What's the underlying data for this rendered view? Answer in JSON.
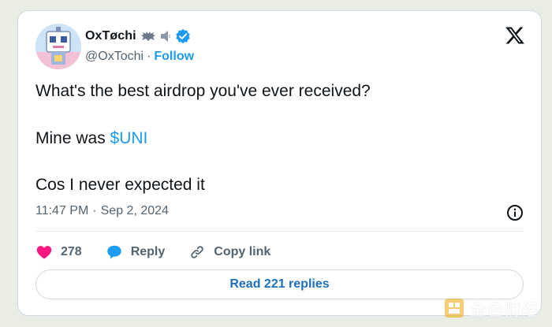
{
  "tweet": {
    "display_name": "OxTøchi",
    "handle": "@OxTochi",
    "separator": "·",
    "follow_label": "Follow",
    "lines": [
      "What's the best airdrop you've ever received?",
      "Mine was ",
      "Cos I never expected it"
    ],
    "cashtag": "$UNI",
    "time": "11:47 PM",
    "date": "Sep 2, 2024",
    "likes": "278",
    "reply_label": "Reply",
    "copy_link_label": "Copy link",
    "read_replies_label": "Read 221 replies"
  },
  "watermark": {
    "text": "金色财经"
  },
  "icons": {
    "avatar": "robot-avatar",
    "verified": "verified-badge-icon",
    "close": "x-logo-icon",
    "info": "info-icon",
    "like": "heart-icon",
    "reply": "reply-bubble-icon",
    "copy": "link-icon"
  },
  "colors": {
    "accent": "#1d9bf0",
    "like": "#f91880",
    "reply": "#1d9bf0",
    "text": "#0f1419",
    "muted": "#536471",
    "border": "#cfd9de"
  }
}
